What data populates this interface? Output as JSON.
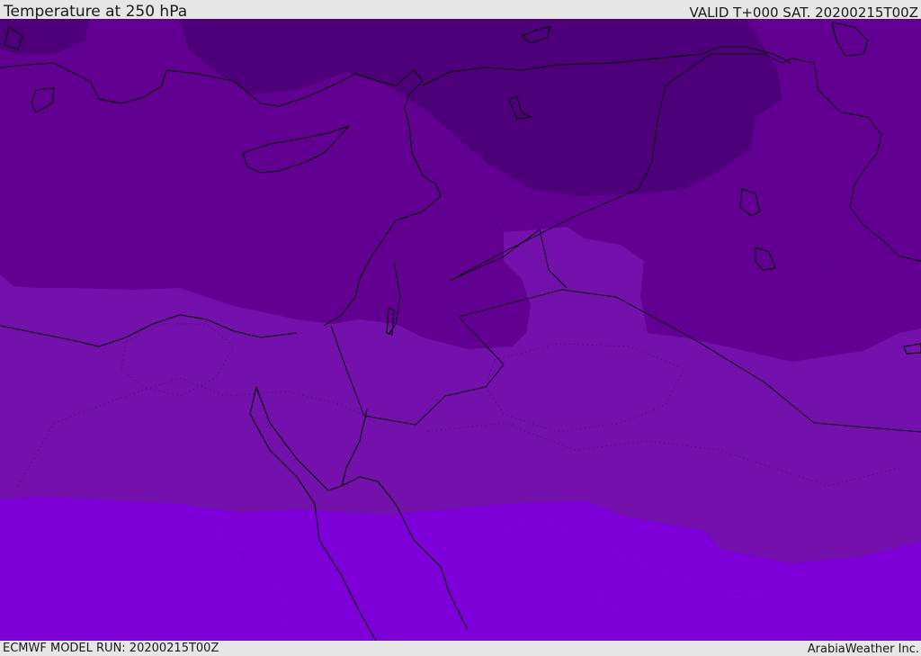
{
  "header": {
    "title": "Temperature at 250 hPa",
    "valid": "VALID T+000 SAT. 20200215T00Z"
  },
  "footer": {
    "model_run": "ECMWF MODEL RUN: 20200215T00Z",
    "credit": "ArabiaWeather Inc."
  },
  "map": {
    "colors": {
      "band_coldest": "#4e007a",
      "band_cold": "#620092",
      "band_mid": "#7410ac",
      "band_warm": "#7e00d8",
      "coastline": "#000000",
      "border": "#000000"
    }
  }
}
